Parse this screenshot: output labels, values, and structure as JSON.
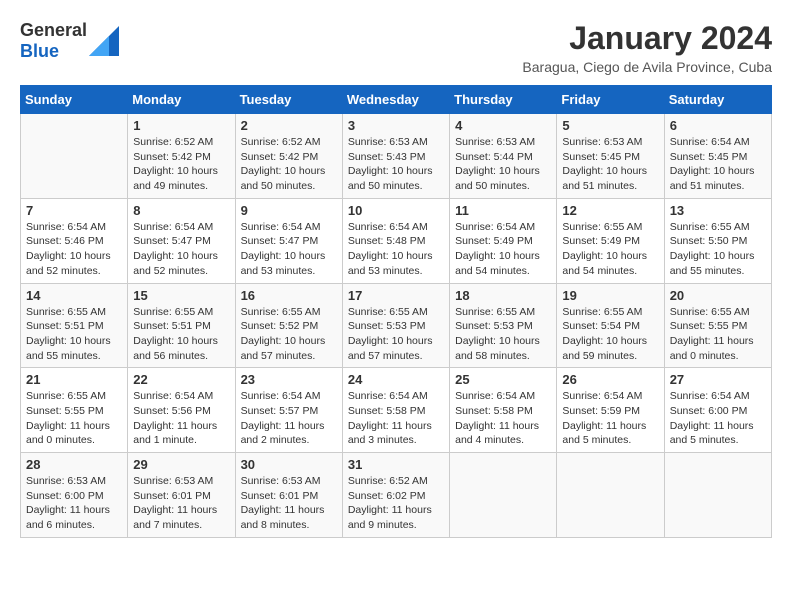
{
  "header": {
    "logo_general": "General",
    "logo_blue": "Blue",
    "month": "January 2024",
    "location": "Baragua, Ciego de Avila Province, Cuba"
  },
  "days_of_week": [
    "Sunday",
    "Monday",
    "Tuesday",
    "Wednesday",
    "Thursday",
    "Friday",
    "Saturday"
  ],
  "weeks": [
    [
      {
        "day": "",
        "info": ""
      },
      {
        "day": "1",
        "info": "Sunrise: 6:52 AM\nSunset: 5:42 PM\nDaylight: 10 hours\nand 49 minutes."
      },
      {
        "day": "2",
        "info": "Sunrise: 6:52 AM\nSunset: 5:42 PM\nDaylight: 10 hours\nand 50 minutes."
      },
      {
        "day": "3",
        "info": "Sunrise: 6:53 AM\nSunset: 5:43 PM\nDaylight: 10 hours\nand 50 minutes."
      },
      {
        "day": "4",
        "info": "Sunrise: 6:53 AM\nSunset: 5:44 PM\nDaylight: 10 hours\nand 50 minutes."
      },
      {
        "day": "5",
        "info": "Sunrise: 6:53 AM\nSunset: 5:45 PM\nDaylight: 10 hours\nand 51 minutes."
      },
      {
        "day": "6",
        "info": "Sunrise: 6:54 AM\nSunset: 5:45 PM\nDaylight: 10 hours\nand 51 minutes."
      }
    ],
    [
      {
        "day": "7",
        "info": "Sunrise: 6:54 AM\nSunset: 5:46 PM\nDaylight: 10 hours\nand 52 minutes."
      },
      {
        "day": "8",
        "info": "Sunrise: 6:54 AM\nSunset: 5:47 PM\nDaylight: 10 hours\nand 52 minutes."
      },
      {
        "day": "9",
        "info": "Sunrise: 6:54 AM\nSunset: 5:47 PM\nDaylight: 10 hours\nand 53 minutes."
      },
      {
        "day": "10",
        "info": "Sunrise: 6:54 AM\nSunset: 5:48 PM\nDaylight: 10 hours\nand 53 minutes."
      },
      {
        "day": "11",
        "info": "Sunrise: 6:54 AM\nSunset: 5:49 PM\nDaylight: 10 hours\nand 54 minutes."
      },
      {
        "day": "12",
        "info": "Sunrise: 6:55 AM\nSunset: 5:49 PM\nDaylight: 10 hours\nand 54 minutes."
      },
      {
        "day": "13",
        "info": "Sunrise: 6:55 AM\nSunset: 5:50 PM\nDaylight: 10 hours\nand 55 minutes."
      }
    ],
    [
      {
        "day": "14",
        "info": "Sunrise: 6:55 AM\nSunset: 5:51 PM\nDaylight: 10 hours\nand 55 minutes."
      },
      {
        "day": "15",
        "info": "Sunrise: 6:55 AM\nSunset: 5:51 PM\nDaylight: 10 hours\nand 56 minutes."
      },
      {
        "day": "16",
        "info": "Sunrise: 6:55 AM\nSunset: 5:52 PM\nDaylight: 10 hours\nand 57 minutes."
      },
      {
        "day": "17",
        "info": "Sunrise: 6:55 AM\nSunset: 5:53 PM\nDaylight: 10 hours\nand 57 minutes."
      },
      {
        "day": "18",
        "info": "Sunrise: 6:55 AM\nSunset: 5:53 PM\nDaylight: 10 hours\nand 58 minutes."
      },
      {
        "day": "19",
        "info": "Sunrise: 6:55 AM\nSunset: 5:54 PM\nDaylight: 10 hours\nand 59 minutes."
      },
      {
        "day": "20",
        "info": "Sunrise: 6:55 AM\nSunset: 5:55 PM\nDaylight: 11 hours\nand 0 minutes."
      }
    ],
    [
      {
        "day": "21",
        "info": "Sunrise: 6:55 AM\nSunset: 5:55 PM\nDaylight: 11 hours\nand 0 minutes."
      },
      {
        "day": "22",
        "info": "Sunrise: 6:54 AM\nSunset: 5:56 PM\nDaylight: 11 hours\nand 1 minute."
      },
      {
        "day": "23",
        "info": "Sunrise: 6:54 AM\nSunset: 5:57 PM\nDaylight: 11 hours\nand 2 minutes."
      },
      {
        "day": "24",
        "info": "Sunrise: 6:54 AM\nSunset: 5:58 PM\nDaylight: 11 hours\nand 3 minutes."
      },
      {
        "day": "25",
        "info": "Sunrise: 6:54 AM\nSunset: 5:58 PM\nDaylight: 11 hours\nand 4 minutes."
      },
      {
        "day": "26",
        "info": "Sunrise: 6:54 AM\nSunset: 5:59 PM\nDaylight: 11 hours\nand 5 minutes."
      },
      {
        "day": "27",
        "info": "Sunrise: 6:54 AM\nSunset: 6:00 PM\nDaylight: 11 hours\nand 5 minutes."
      }
    ],
    [
      {
        "day": "28",
        "info": "Sunrise: 6:53 AM\nSunset: 6:00 PM\nDaylight: 11 hours\nand 6 minutes."
      },
      {
        "day": "29",
        "info": "Sunrise: 6:53 AM\nSunset: 6:01 PM\nDaylight: 11 hours\nand 7 minutes."
      },
      {
        "day": "30",
        "info": "Sunrise: 6:53 AM\nSunset: 6:01 PM\nDaylight: 11 hours\nand 8 minutes."
      },
      {
        "day": "31",
        "info": "Sunrise: 6:52 AM\nSunset: 6:02 PM\nDaylight: 11 hours\nand 9 minutes."
      },
      {
        "day": "",
        "info": ""
      },
      {
        "day": "",
        "info": ""
      },
      {
        "day": "",
        "info": ""
      }
    ]
  ]
}
